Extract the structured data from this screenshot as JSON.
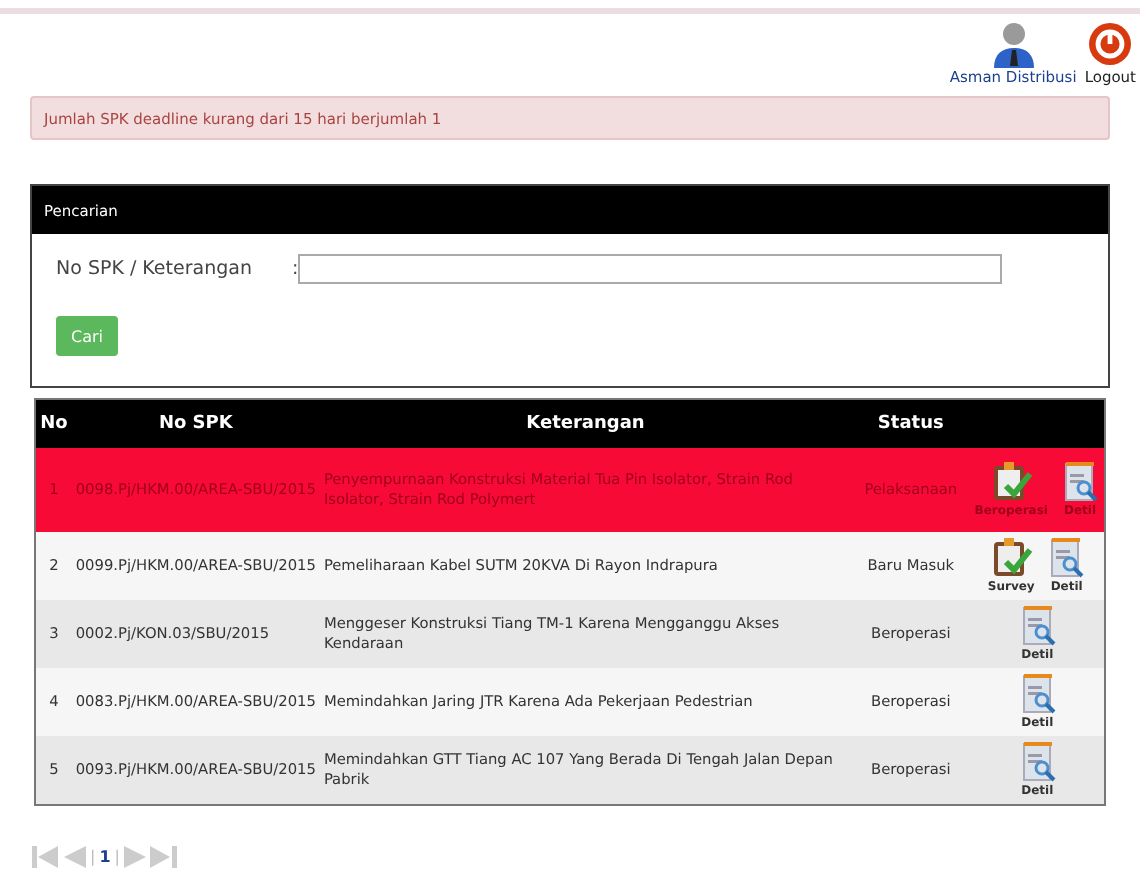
{
  "header": {
    "user": {
      "label": "Asman Distribusi"
    },
    "logout": {
      "label": "Logout"
    }
  },
  "alert": {
    "text": "Jumlah SPK deadline kurang dari 15 hari berjumlah 1"
  },
  "search": {
    "title": "Pencarian",
    "field_label": "No SPK / Keterangan",
    "colon": ":",
    "button": "Cari"
  },
  "table": {
    "columns": [
      "No",
      "No SPK",
      "Keterangan",
      "Status"
    ],
    "rows": [
      {
        "no": "1",
        "spk": "0098.Pj/HKM.00/AREA-SBU/2015",
        "keterangan": "Penyempurnaan Konstruksi Material Tua Pin Isolator, Strain Rod Isolator, Strain Rod Polymert",
        "status": "Pelaksanaan",
        "highlighted": true,
        "actions": [
          {
            "kind": "survey",
            "label": "Beroperasi"
          },
          {
            "kind": "detail",
            "label": "Detil"
          }
        ]
      },
      {
        "no": "2",
        "spk": "0099.Pj/HKM.00/AREA-SBU/2015",
        "keterangan": "Pemeliharaan Kabel SUTM 20KVA Di Rayon Indrapura",
        "status": "Baru Masuk",
        "highlighted": false,
        "actions": [
          {
            "kind": "survey",
            "label": "Survey"
          },
          {
            "kind": "detail",
            "label": "Detil"
          }
        ]
      },
      {
        "no": "3",
        "spk": "0002.Pj/KON.03/SBU/2015",
        "keterangan": "Menggeser Konstruksi Tiang TM-1 Karena Mengganggu Akses Kendaraan",
        "status": "Beroperasi",
        "highlighted": false,
        "actions": [
          {
            "kind": "detail",
            "label": "Detil"
          }
        ]
      },
      {
        "no": "4",
        "spk": "0083.Pj/HKM.00/AREA-SBU/2015",
        "keterangan": "Memindahkan Jaring JTR Karena Ada Pekerjaan Pedestrian",
        "status": "Beroperasi",
        "highlighted": false,
        "actions": [
          {
            "kind": "detail",
            "label": "Detil"
          }
        ]
      },
      {
        "no": "5",
        "spk": "0093.Pj/HKM.00/AREA-SBU/2015",
        "keterangan": "Memindahkan GTT Tiang AC 107 Yang Berada Di Tengah Jalan Depan Pabrik",
        "status": "Beroperasi",
        "highlighted": false,
        "actions": [
          {
            "kind": "detail",
            "label": "Detil"
          }
        ]
      }
    ]
  },
  "pager": {
    "separator": "|",
    "pages": [
      {
        "label": "1",
        "selected": true
      }
    ]
  }
}
